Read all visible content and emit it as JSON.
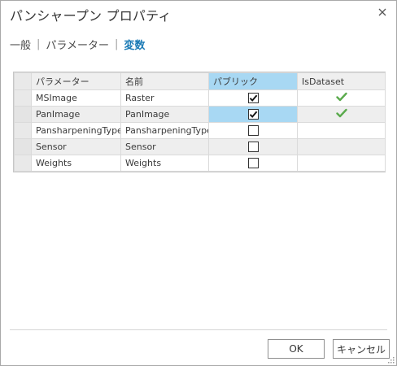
{
  "window": {
    "title": "パンシャープン プロパティ"
  },
  "tabs": [
    {
      "label": "一般",
      "active": false
    },
    {
      "label": "パラメーター",
      "active": false
    },
    {
      "label": "変数",
      "active": true
    }
  ],
  "table": {
    "columns": [
      "パラメーター",
      "名前",
      "パブリック",
      "IsDataset"
    ],
    "selected_column": "パブリック",
    "rows": [
      {
        "parameter": "MSImage",
        "name": "Raster",
        "public": true,
        "is_dataset": true
      },
      {
        "parameter": "PanImage",
        "name": "PanImage",
        "public": true,
        "is_dataset": true
      },
      {
        "parameter": "PansharpeningType",
        "name": "PansharpeningType",
        "public": false,
        "is_dataset": false
      },
      {
        "parameter": "Sensor",
        "name": "Sensor",
        "public": false,
        "is_dataset": false
      },
      {
        "parameter": "Weights",
        "name": "Weights",
        "public": false,
        "is_dataset": false
      }
    ]
  },
  "buttons": {
    "ok": "OK",
    "cancel": "キャンセル"
  },
  "colors": {
    "accent": "#1a7ab5",
    "selection": "#a8d8f3",
    "check_green": "#5aaa4c"
  },
  "icons": {
    "close": "close-icon",
    "dataset_check": "green-checkmark-icon",
    "resize": "resize-grip-icon"
  }
}
